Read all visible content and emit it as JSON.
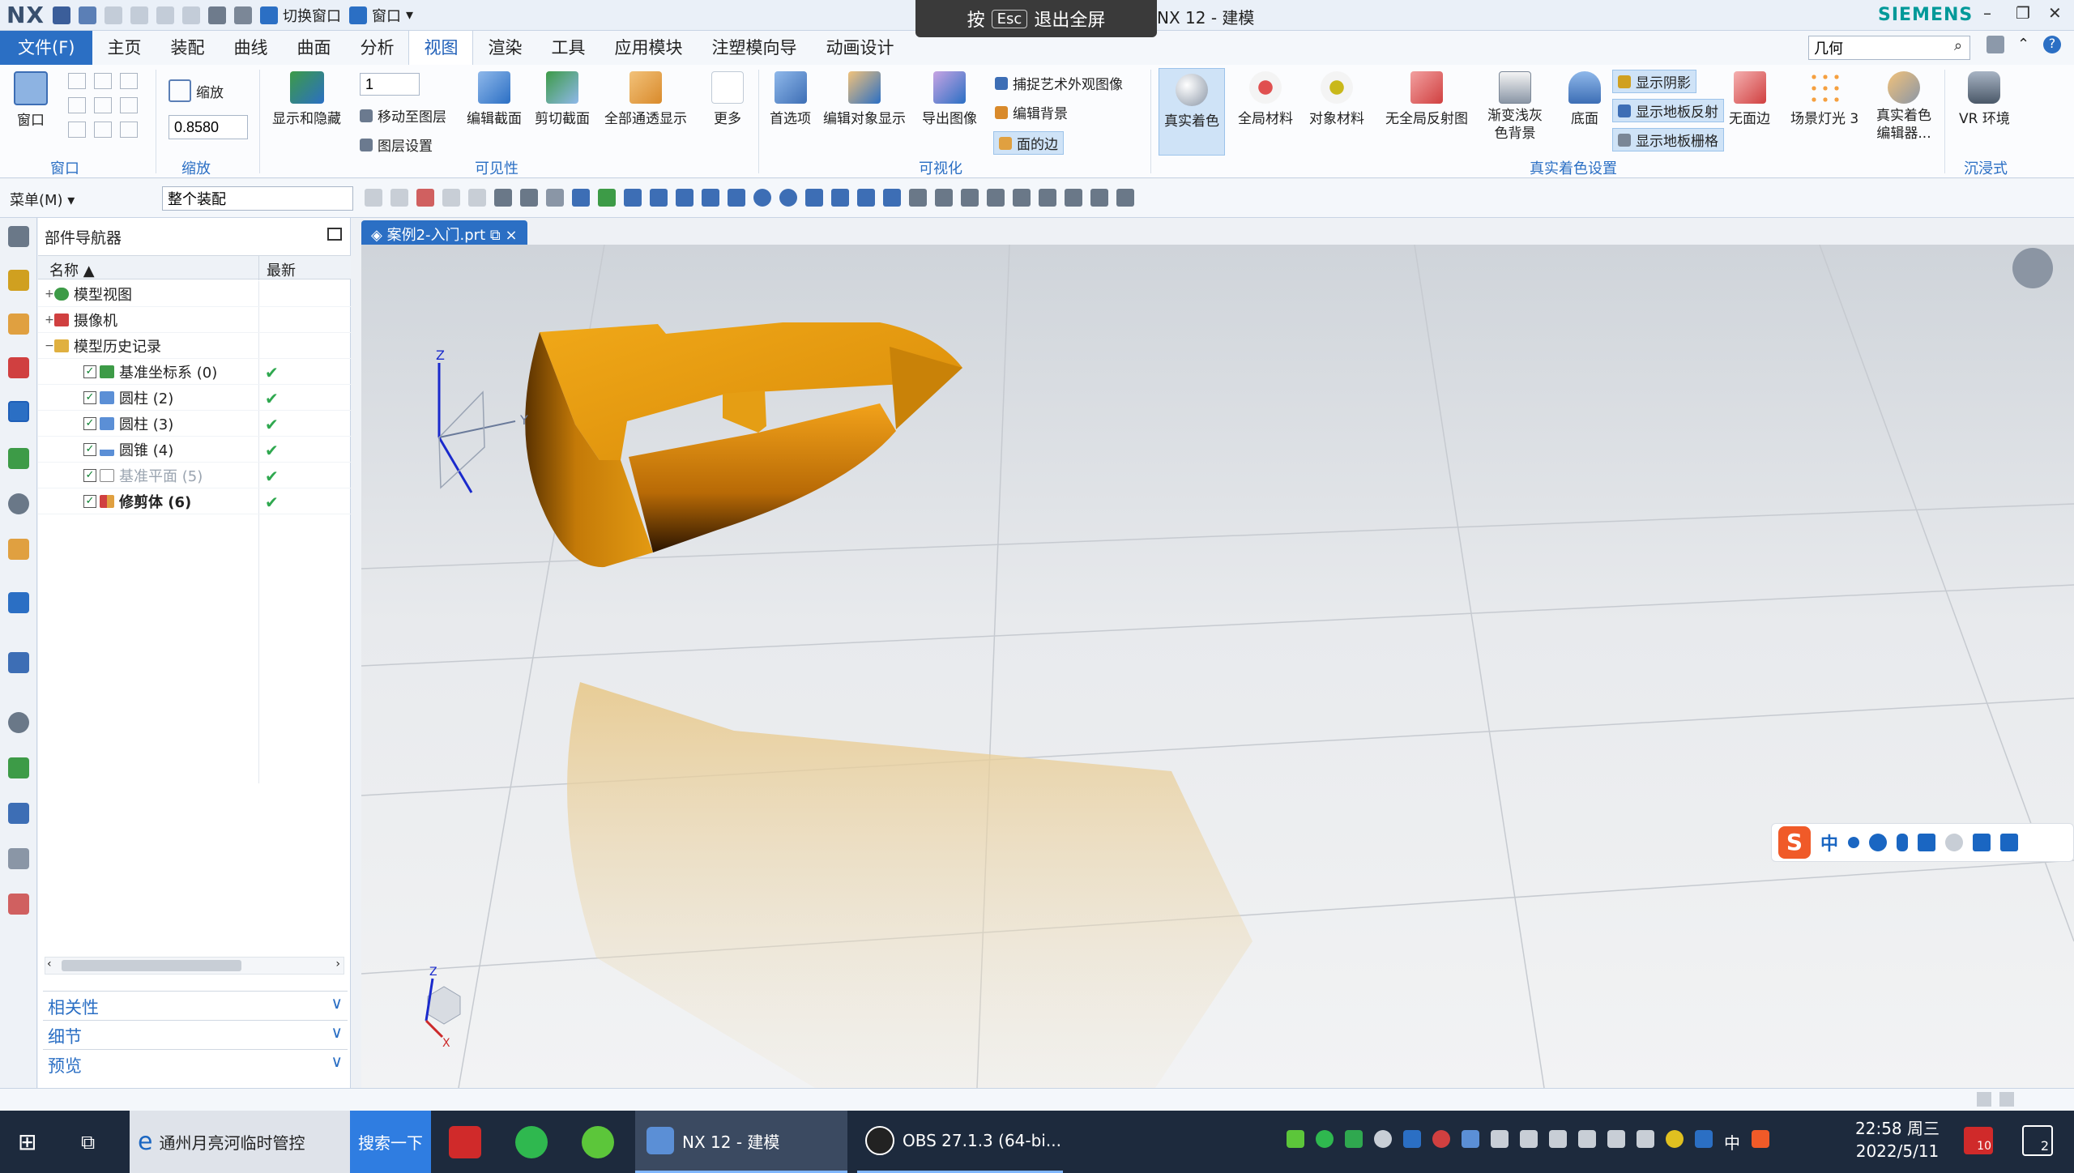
{
  "title_bar": {
    "logo": "NX",
    "switch_window": "切换窗口",
    "window_menu": "窗口",
    "app_title": "NX 12 - 建模",
    "brand": "SIEMENS",
    "minimize": "–",
    "restore": "❐",
    "close": "✕"
  },
  "esc_banner": {
    "press": "按",
    "key": "Esc",
    "action": "退出全屏"
  },
  "menu_tabs": {
    "file": "文件(F)",
    "tabs": [
      "主页",
      "装配",
      "曲线",
      "曲面",
      "分析",
      "视图",
      "渲染",
      "工具",
      "应用模块",
      "注塑模向导",
      "动画设计"
    ],
    "active": "视图",
    "search_value": "几何"
  },
  "ribbon": {
    "window_group": {
      "button": "窗口",
      "label": "窗口"
    },
    "zoom_group": {
      "button": "缩放",
      "value": "0.8580",
      "label": "缩放"
    },
    "visibility_group": {
      "show_hide": "显示和隐藏",
      "layer_value": "1",
      "move_to_layer": "移动至图层",
      "layer_settings": "图层设置",
      "edit_section": "编辑截面",
      "clip_section": "剪切截面",
      "all_transparent": "全部通透显示",
      "more": "更多",
      "label": "可见性"
    },
    "visualize_group": {
      "preferences": "首选项",
      "edit_object_display": "编辑对象显示",
      "export_image": "导出图像",
      "capture_art": "捕捉艺术外观图像",
      "edit_background": "编辑背景",
      "face_edges": "面的边",
      "label": "可视化"
    },
    "true_shading_group": {
      "true_shading": "真实着色",
      "global_material": "全局材料",
      "object_material": "对象材料",
      "no_global_reflection": "无全局反射图",
      "gradient_bg": "渐变浅灰色背景",
      "floor": "底面",
      "show_shadow": "显示阴影",
      "show_floor_reflection": "显示地板反射",
      "show_floor_grid": "显示地板栅格",
      "no_face_edges": "无面边",
      "scene_light": "场景灯光 3",
      "true_shading_editor": "真实着色编辑器...",
      "vr_env": "VR 环境",
      "label": "真实着色设置",
      "immersive_label": "沉浸式"
    }
  },
  "toolbar2": {
    "menu": "菜单(M)",
    "scope_value": "整个装配"
  },
  "navigator": {
    "title": "部件导航器",
    "col_name": "名称",
    "col_latest": "最新",
    "items": [
      {
        "label": "模型视图",
        "level": 0,
        "toggle": "+"
      },
      {
        "label": "摄像机",
        "level": 0,
        "toggle": "+"
      },
      {
        "label": "模型历史记录",
        "level": 0,
        "toggle": "−"
      },
      {
        "label": "基准坐标系 (0)",
        "level": 1,
        "latest": "✔"
      },
      {
        "label": "圆柱 (2)",
        "level": 1,
        "latest": "✔"
      },
      {
        "label": "圆柱 (3)",
        "level": 1,
        "latest": "✔"
      },
      {
        "label": "圆锥 (4)",
        "level": 1,
        "latest": "✔"
      },
      {
        "label": "基准平面 (5)",
        "level": 1,
        "latest": "✔",
        "dim": true
      },
      {
        "label": "修剪体 (6)",
        "level": 1,
        "latest": "✔",
        "bold": true
      }
    ],
    "panels": [
      "相关性",
      "细节",
      "预览"
    ]
  },
  "document_tab": {
    "label": "案例2-入门.prt",
    "close": "×"
  },
  "viewport": {
    "axis_z": "Z",
    "axis_y": "Y",
    "triad_z": "Z",
    "triad_x": "X",
    "model_color": "#e09a10"
  },
  "ime_bar": {
    "logo": "S",
    "lang": "中"
  },
  "taskbar": {
    "browser_item": "通州月亮河临时管控",
    "search_button": "搜索一下",
    "nx_item": "NX 12 - 建模",
    "obs_item": "OBS 27.1.3 (64-bi...",
    "ime_lang": "中",
    "time": "22:58 周三",
    "date": "2022/5/11",
    "notif_badge": "10",
    "action_badge": "2"
  }
}
